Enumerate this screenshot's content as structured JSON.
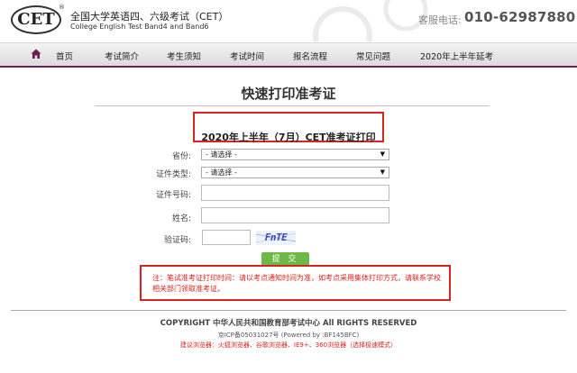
{
  "header": {
    "logo_text": "CET",
    "logo_reg": "®",
    "title_cn": "全国大学英语四、六级考试（CET）",
    "title_en": "College English Test Band4 and Band6",
    "phone_label": "客服电话:",
    "phone_number": "010-62987880"
  },
  "nav": {
    "home_icon": "home-icon",
    "items": [
      "首页",
      "考试简介",
      "考生须知",
      "考试时间",
      "报名流程",
      "常见问题",
      "2020年上半年延考"
    ]
  },
  "page": {
    "title": "快速打印准考证",
    "exam_name": "2020年上半年（7月）CET准考证打印"
  },
  "form": {
    "province_label": "省份:",
    "province_value": "- 请选择 -",
    "id_type_label": "证件类型:",
    "id_type_value": "- 请选择 -",
    "id_number_label": "证件号码:",
    "name_label": "姓名:",
    "captcha_label": "验证码:",
    "captcha_text": "FnTE",
    "submit_label": "提 交"
  },
  "notice": {
    "text": "注：笔试准考证打印时间：请以考点通知时间为准，如考点采用集体打印方式，请联系学校相关部门领取准考证。"
  },
  "footer": {
    "copyright": "COPYRIGHT 中华人民共和国教育部考试中心 All RIGHTS RESERVED",
    "icp": "京ICP备05031027号 (Powered by :BF145BFC)",
    "browser_tip": "建议浏览器：火狐浏览器、谷歌浏览器、IE9+、360浏览器（选择极速模式）"
  },
  "colors": {
    "nav_accent": "#6d1f4f",
    "alert_red": "#d9231d",
    "submit_green": "#6cb946"
  }
}
